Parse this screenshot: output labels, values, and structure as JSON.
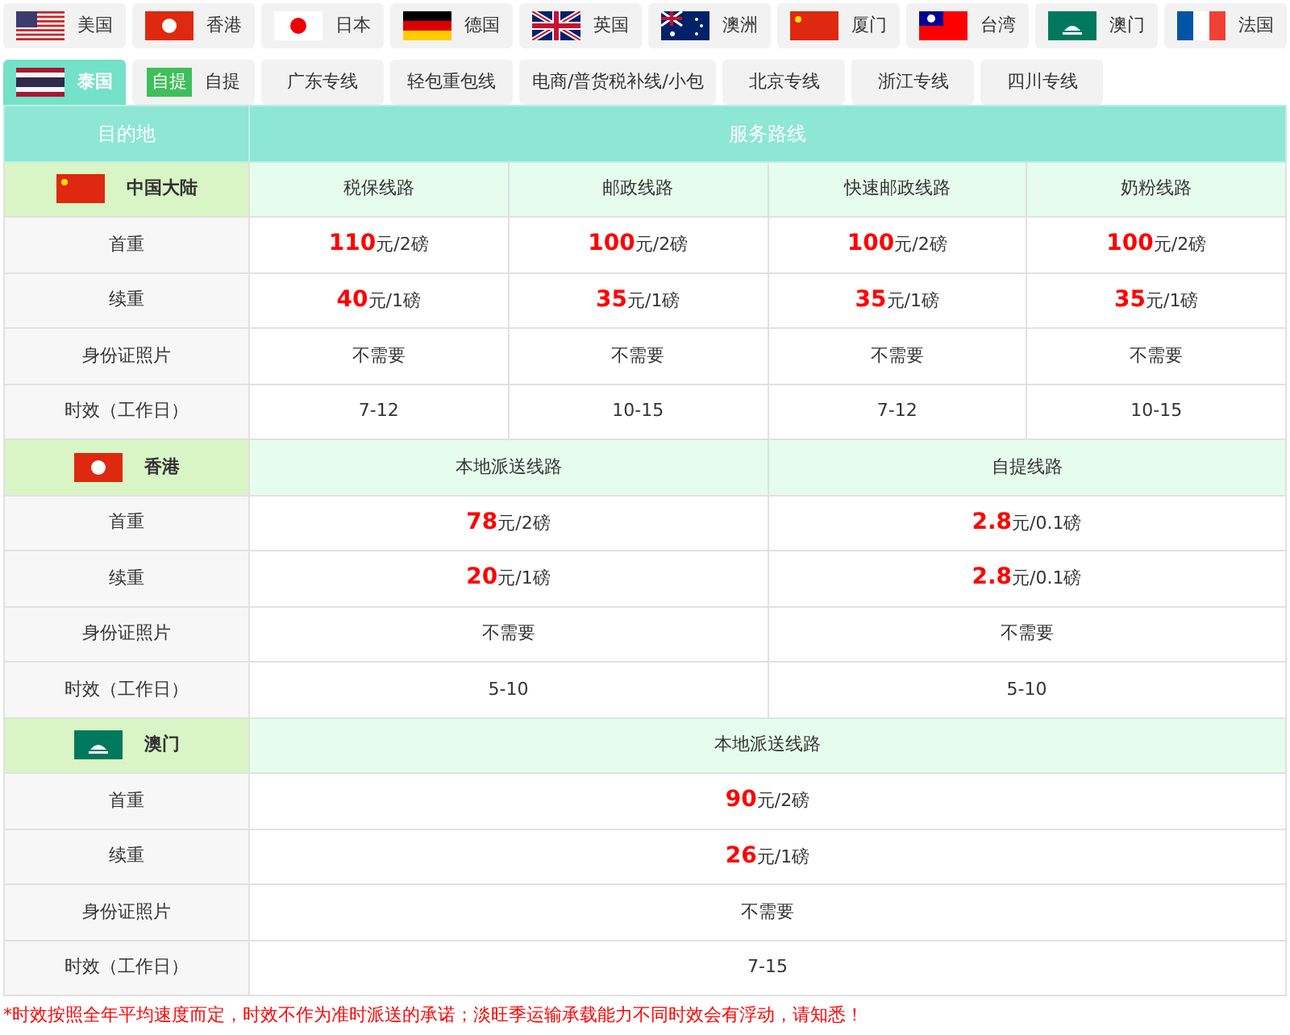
{
  "tabs": [
    {
      "label": "美国",
      "selected": false,
      "kind": "flag"
    },
    {
      "label": "香港",
      "selected": false,
      "kind": "flag"
    },
    {
      "label": "日本",
      "selected": false,
      "kind": "flag"
    },
    {
      "label": "德国",
      "selected": false,
      "kind": "flag"
    },
    {
      "label": "英国",
      "selected": false,
      "kind": "flag"
    },
    {
      "label": "澳洲",
      "selected": false,
      "kind": "flag"
    },
    {
      "label": "厦门",
      "selected": false,
      "kind": "flag"
    },
    {
      "label": "台湾",
      "selected": false,
      "kind": "flag"
    },
    {
      "label": "澳门",
      "selected": false,
      "kind": "flag"
    },
    {
      "label": "法国",
      "selected": false,
      "kind": "flag"
    },
    {
      "label": "泰国",
      "selected": true,
      "kind": "flag"
    },
    {
      "label": "自提",
      "selected": false,
      "kind": "badge",
      "badge": "自提"
    },
    {
      "label": "广东专线",
      "selected": false,
      "kind": "text"
    },
    {
      "label": "轻包重包线",
      "selected": false,
      "kind": "text"
    },
    {
      "label": "电商/普货税补线/小包",
      "selected": false,
      "kind": "text"
    },
    {
      "label": "北京专线",
      "selected": false,
      "kind": "text"
    },
    {
      "label": "浙江专线",
      "selected": false,
      "kind": "text"
    },
    {
      "label": "四川专线",
      "selected": false,
      "kind": "text"
    }
  ],
  "table": {
    "columns": [
      "目的地",
      "服务路线"
    ],
    "sections": [
      {
        "region": "中国大陆",
        "routes": [
          "税保线路",
          "邮政线路",
          "快速邮政线路",
          "奶粉线路"
        ],
        "rows": [
          {
            "label": "首重",
            "cells": [
              {
                "kind": "price",
                "amount": "110",
                "unit": "元/2磅"
              },
              {
                "kind": "price",
                "amount": "100",
                "unit": "元/2磅"
              },
              {
                "kind": "price",
                "amount": "100",
                "unit": "元/2磅"
              },
              {
                "kind": "price",
                "amount": "100",
                "unit": "元/2磅"
              }
            ]
          },
          {
            "label": "续重",
            "cells": [
              {
                "kind": "price",
                "amount": "40",
                "unit": "元/1磅"
              },
              {
                "kind": "price",
                "amount": "35",
                "unit": "元/1磅"
              },
              {
                "kind": "price",
                "amount": "35",
                "unit": "元/1磅"
              },
              {
                "kind": "price",
                "amount": "35",
                "unit": "元/1磅"
              }
            ]
          },
          {
            "label": "身份证照片",
            "cells": [
              {
                "kind": "text",
                "text": "不需要"
              },
              {
                "kind": "text",
                "text": "不需要"
              },
              {
                "kind": "text",
                "text": "不需要"
              },
              {
                "kind": "text",
                "text": "不需要"
              }
            ]
          },
          {
            "label": "时效（工作日）",
            "cells": [
              {
                "kind": "text",
                "text": "7-12"
              },
              {
                "kind": "text",
                "text": "10-15"
              },
              {
                "kind": "text",
                "text": "7-12"
              },
              {
                "kind": "text",
                "text": "10-15"
              }
            ]
          }
        ]
      },
      {
        "region": "香港",
        "routes": [
          "本地派送线路",
          "自提线路"
        ],
        "rows": [
          {
            "label": "首重",
            "cells": [
              {
                "kind": "price",
                "amount": "78",
                "unit": "元/2磅"
              },
              {
                "kind": "price",
                "amount": "2.8",
                "unit": "元/0.1磅"
              }
            ]
          },
          {
            "label": "续重",
            "cells": [
              {
                "kind": "price",
                "amount": "20",
                "unit": "元/1磅"
              },
              {
                "kind": "price",
                "amount": "2.8",
                "unit": "元/0.1磅"
              }
            ]
          },
          {
            "label": "身份证照片",
            "cells": [
              {
                "kind": "text",
                "text": "不需要"
              },
              {
                "kind": "text",
                "text": "不需要"
              }
            ]
          },
          {
            "label": "时效（工作日）",
            "cells": [
              {
                "kind": "text",
                "text": "5-10"
              },
              {
                "kind": "text",
                "text": "5-10"
              }
            ]
          }
        ]
      },
      {
        "region": "澳门",
        "routes": [
          "本地派送线路"
        ],
        "rows": [
          {
            "label": "首重",
            "cells": [
              {
                "kind": "price",
                "amount": "90",
                "unit": "元/2磅"
              }
            ]
          },
          {
            "label": "续重",
            "cells": [
              {
                "kind": "price",
                "amount": "26",
                "unit": "元/1磅"
              }
            ]
          },
          {
            "label": "身份证照片",
            "cells": [
              {
                "kind": "text",
                "text": "不需要"
              }
            ]
          },
          {
            "label": "时效（工作日）",
            "cells": [
              {
                "kind": "text",
                "text": "7-15"
              }
            ]
          }
        ]
      }
    ]
  },
  "footnote": "*时效按照全年平均速度而定，时效不作为准时派送的承诺；淡旺季运输承载能力不同时效会有浮动，请知悉！"
}
